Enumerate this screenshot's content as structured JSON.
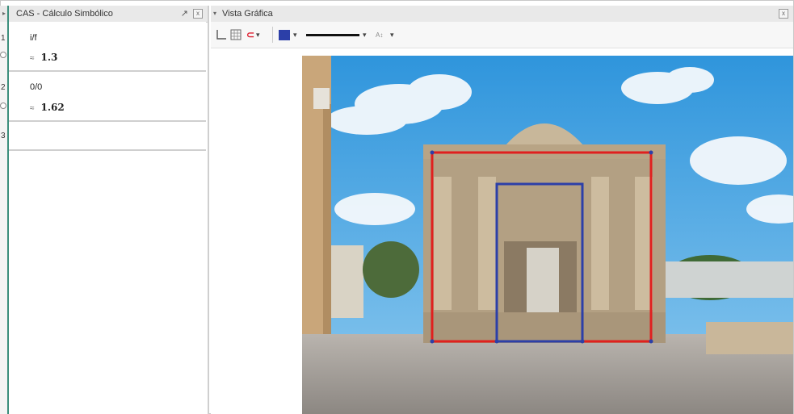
{
  "cas": {
    "title": "CAS - Cálculo Simbólico",
    "undock_glyph": "↗",
    "close_glyph": "x",
    "rows": [
      {
        "num": "1",
        "input": "i/f",
        "output": "1.3"
      },
      {
        "num": "2",
        "input": "0/0",
        "output": "1.62"
      },
      {
        "num": "3",
        "input": "",
        "output": ""
      }
    ],
    "output_marker": "≈"
  },
  "graphics": {
    "title": "Vista Gráfica",
    "close_glyph": "x",
    "toolbar": {
      "axes_icon": "axes-icon",
      "grid_icon": "grid-icon",
      "point_capture_label": "⊂",
      "dropdown": "▾",
      "color": "#2c3fa8",
      "label_style": "A↕"
    }
  },
  "colors": {
    "accent_green": "#3b8e7c",
    "outer_rectangle": "#e0201e",
    "inner_rectangle": "#2c3fa8",
    "sky": "#3a9fe0"
  }
}
